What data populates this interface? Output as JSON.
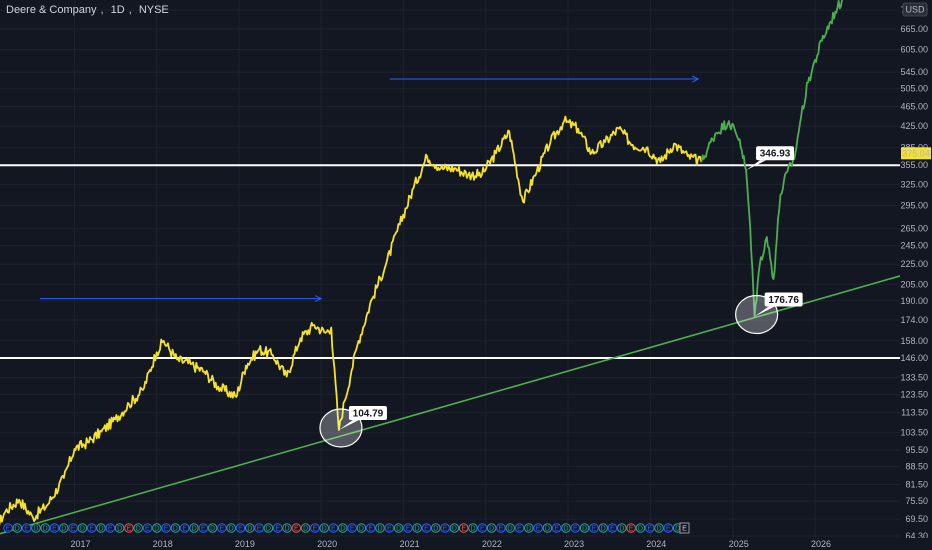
{
  "header": {
    "company": "Deere & Company",
    "interval": "1D",
    "exchange": "NYSE"
  },
  "currency_button": "USD",
  "colors": {
    "background": "#131722",
    "price_history": "#f5e32a",
    "price_projection": "#4caf50",
    "trendline": "#4caf50",
    "support_lines": "#ffffff",
    "arrows": "#2962ff",
    "last_price_bg": "#f5e32a",
    "dividend_event": "#26a69a",
    "earnings_event": "#2962ff",
    "earnings_negative": "#ef5350"
  },
  "chart_data": {
    "type": "line",
    "y_scale": "log",
    "ylim": [
      64.3,
      760
    ],
    "y_ticks": [
      "725.00",
      "665.00",
      "605.00",
      "545.00",
      "505.00",
      "465.00",
      "425.00",
      "385.00",
      "355.00",
      "325.00",
      "295.00",
      "265.00",
      "245.00",
      "225.00",
      "205.00",
      "190.00",
      "174.00",
      "158.00",
      "146.00",
      "133.50",
      "123.50",
      "113.50",
      "103.50",
      "95.50",
      "88.50",
      "81.50",
      "75.50",
      "69.50",
      "64.30"
    ],
    "x_ticks": [
      "2017",
      "2018",
      "2019",
      "2020",
      "2021",
      "2022",
      "2023",
      "2024",
      "2025",
      "2026"
    ],
    "last_price": "375.04",
    "horizontal_levels": [
      146,
      355
    ],
    "annotations": [
      {
        "label": "104.79",
        "date": "2020-03-20",
        "value": 104.79
      },
      {
        "label": "176.76",
        "date": "2025-04-08",
        "value": 176.76
      },
      {
        "label": "346.93",
        "date": "2025-03-01",
        "value": 346.93
      }
    ],
    "trendline": {
      "start": {
        "date": "2016-01-01",
        "value": 64.3
      },
      "end": {
        "date": "2027-05-01",
        "value": 220
      }
    },
    "arrows": [
      {
        "from": "2016-08-01",
        "to": "2020-01-01",
        "value": 192
      },
      {
        "from": "2020-11-01",
        "to": "2024-08-01",
        "value": 528
      }
    ],
    "series": [
      {
        "role": "history",
        "points": [
          [
            "2016-01-15",
            66
          ],
          [
            "2016-03-01",
            72
          ],
          [
            "2016-05-01",
            76
          ],
          [
            "2016-07-01",
            70
          ],
          [
            "2016-09-01",
            74
          ],
          [
            "2016-11-15",
            84
          ],
          [
            "2017-01-01",
            96
          ],
          [
            "2017-03-01",
            99
          ],
          [
            "2017-05-01",
            104
          ],
          [
            "2017-07-01",
            110
          ],
          [
            "2017-09-01",
            118
          ],
          [
            "2017-11-01",
            126
          ],
          [
            "2018-01-01",
            150
          ],
          [
            "2018-02-01",
            158
          ],
          [
            "2018-04-01",
            145
          ],
          [
            "2018-06-01",
            142
          ],
          [
            "2018-08-01",
            137
          ],
          [
            "2018-10-01",
            128
          ],
          [
            "2018-12-20",
            122
          ],
          [
            "2019-02-01",
            141
          ],
          [
            "2019-04-01",
            152
          ],
          [
            "2019-06-01",
            148
          ],
          [
            "2019-08-01",
            134
          ],
          [
            "2019-10-01",
            160
          ],
          [
            "2019-12-01",
            170
          ],
          [
            "2020-01-20",
            164
          ],
          [
            "2020-02-15",
            168
          ],
          [
            "2020-03-20",
            104.79
          ],
          [
            "2020-04-15",
            120
          ],
          [
            "2020-05-15",
            138
          ],
          [
            "2020-06-15",
            158
          ],
          [
            "2020-08-15",
            192
          ],
          [
            "2020-10-15",
            225
          ],
          [
            "2020-12-15",
            270
          ],
          [
            "2021-02-15",
            320
          ],
          [
            "2021-04-15",
            370
          ],
          [
            "2021-06-15",
            350
          ],
          [
            "2021-08-15",
            350
          ],
          [
            "2021-10-15",
            340
          ],
          [
            "2021-12-15",
            340
          ],
          [
            "2022-02-15",
            375
          ],
          [
            "2022-04-15",
            415
          ],
          [
            "2022-06-15",
            300
          ],
          [
            "2022-08-15",
            345
          ],
          [
            "2022-10-15",
            395
          ],
          [
            "2022-12-15",
            435
          ],
          [
            "2023-02-15",
            420
          ],
          [
            "2023-04-15",
            375
          ],
          [
            "2023-06-15",
            395
          ],
          [
            "2023-08-15",
            420
          ],
          [
            "2023-10-15",
            390
          ],
          [
            "2023-12-15",
            385
          ],
          [
            "2024-02-15",
            360
          ],
          [
            "2024-04-15",
            392
          ],
          [
            "2024-06-15",
            370
          ],
          [
            "2024-08-15",
            360
          ]
        ]
      },
      {
        "role": "projection",
        "points": [
          [
            "2024-08-15",
            360
          ],
          [
            "2024-10-15",
            410
          ],
          [
            "2024-12-15",
            435
          ],
          [
            "2025-02-01",
            400
          ],
          [
            "2025-03-01",
            346.93
          ],
          [
            "2025-03-20",
            265
          ],
          [
            "2025-04-08",
            176.76
          ],
          [
            "2025-05-01",
            225
          ],
          [
            "2025-06-01",
            255
          ],
          [
            "2025-07-01",
            210
          ],
          [
            "2025-08-01",
            310
          ],
          [
            "2025-09-01",
            345
          ],
          [
            "2025-10-01",
            365
          ],
          [
            "2025-11-01",
            445
          ],
          [
            "2025-12-01",
            520
          ],
          [
            "2026-02-01",
            630
          ],
          [
            "2026-04-01",
            720
          ],
          [
            "2026-05-01",
            760
          ]
        ]
      }
    ],
    "event_markers": {
      "dividend_label": "D",
      "earnings_label": "E",
      "sequence": [
        "E",
        "D",
        "E",
        "D",
        "D",
        "E",
        "D",
        "E",
        "D",
        "E",
        "D",
        "E",
        "D",
        "E",
        "D",
        "E",
        "D",
        "E",
        "D",
        "E",
        "D",
        "E",
        "D",
        "E",
        "D",
        "E",
        "D",
        "E",
        "D",
        "E",
        "D",
        "E",
        "D",
        "E",
        "D",
        "E",
        "D",
        "E",
        "D",
        "E",
        "D",
        "E",
        "D",
        "E",
        "D",
        "E",
        "D",
        "E",
        "D",
        "E",
        "D",
        "E",
        "D",
        "E",
        "D",
        "E",
        "D",
        "E",
        "D",
        "E",
        "D",
        "E",
        "D",
        "E",
        "D",
        "E",
        "D",
        "E",
        "D",
        "E",
        "D",
        "E",
        "D",
        "E"
      ],
      "last_pending": "E"
    }
  }
}
